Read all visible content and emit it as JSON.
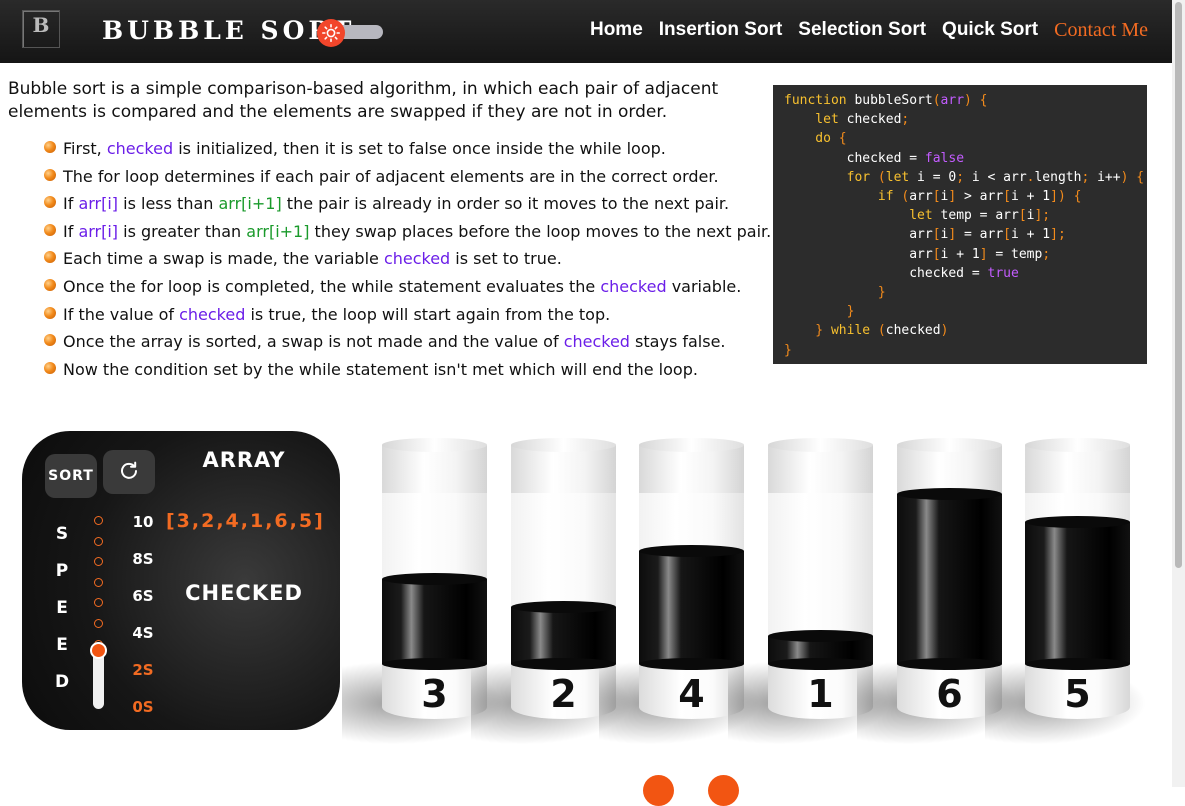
{
  "nav": {
    "logo": "B",
    "brand": "BUBBLE SORT",
    "links": [
      "Home",
      "Insertion Sort",
      "Selection Sort",
      "Quick Sort",
      "Contact Me"
    ],
    "active": "Contact Me",
    "theme_toggle_icon": "sun-icon"
  },
  "intro": {
    "text": "Bubble sort is a simple comparison-based algorithm, in which each pair of adjacent elements is compared and the elements are swapped if they are not in order."
  },
  "steps": [
    {
      "parts": [
        {
          "t": "First, "
        },
        {
          "t": "checked",
          "c": "purple"
        },
        {
          "t": " is initialized, then it is set to false once inside the while loop."
        }
      ]
    },
    {
      "parts": [
        {
          "t": "The for loop determines if each pair of adjacent elements are in the correct order."
        }
      ]
    },
    {
      "parts": [
        {
          "t": "If "
        },
        {
          "t": "arr[i]",
          "c": "purple"
        },
        {
          "t": " is less than "
        },
        {
          "t": "arr[i+1]",
          "c": "green"
        },
        {
          "t": " the pair is already in order so it moves to the next pair."
        }
      ]
    },
    {
      "parts": [
        {
          "t": "If "
        },
        {
          "t": "arr[i]",
          "c": "purple"
        },
        {
          "t": " is greater than "
        },
        {
          "t": "arr[i+1]",
          "c": "green"
        },
        {
          "t": " they swap places before the loop moves to the next pair."
        }
      ]
    },
    {
      "parts": [
        {
          "t": "Each time a swap is made, the variable "
        },
        {
          "t": "checked",
          "c": "purple"
        },
        {
          "t": " is set to true."
        }
      ]
    },
    {
      "parts": [
        {
          "t": "Once the for loop is completed, the while statement evaluates the "
        },
        {
          "t": "checked",
          "c": "purple"
        },
        {
          "t": " variable."
        }
      ]
    },
    {
      "parts": [
        {
          "t": "If the value of "
        },
        {
          "t": "checked",
          "c": "purple"
        },
        {
          "t": " is true, the loop will start again from the top."
        }
      ]
    },
    {
      "parts": [
        {
          "t": "Once the array is sorted, a swap is not made and the value of "
        },
        {
          "t": "checked",
          "c": "purple"
        },
        {
          "t": " stays false."
        }
      ]
    },
    {
      "parts": [
        {
          "t": "Now the condition set by the while statement isn't met which will end the loop."
        }
      ]
    }
  ],
  "code_lines": [
    [
      [
        "function",
        "kw"
      ],
      [
        " bubbleSort",
        "w"
      ],
      [
        "(",
        "p"
      ],
      [
        "arr",
        "v"
      ],
      [
        ")",
        "p"
      ],
      [
        " {",
        "p"
      ]
    ],
    [
      [
        "    let",
        "kw"
      ],
      [
        " checked",
        "w"
      ],
      [
        ";",
        "p"
      ]
    ],
    [
      [
        "    do",
        "kw"
      ],
      [
        " {",
        "p"
      ]
    ],
    [
      [
        "        checked ",
        "w"
      ],
      [
        "=",
        "w"
      ],
      [
        " false",
        "v"
      ]
    ],
    [
      [
        "        for",
        "kw"
      ],
      [
        " (",
        "p"
      ],
      [
        "let",
        "kw"
      ],
      [
        " i = 0",
        "w"
      ],
      [
        ";",
        "p"
      ],
      [
        " i < arr",
        "w"
      ],
      [
        ".",
        "p"
      ],
      [
        "length",
        "w"
      ],
      [
        ";",
        "p"
      ],
      [
        " i++",
        "w"
      ],
      [
        ")",
        "p"
      ],
      [
        " {",
        "p"
      ]
    ],
    [
      [
        "            if",
        "kw"
      ],
      [
        " (",
        "p"
      ],
      [
        "arr",
        "w"
      ],
      [
        "[",
        "p"
      ],
      [
        "i",
        "w"
      ],
      [
        "]",
        "p"
      ],
      [
        " > arr",
        "w"
      ],
      [
        "[",
        "p"
      ],
      [
        "i + 1",
        "w"
      ],
      [
        "])",
        "p"
      ],
      [
        " {",
        "p"
      ]
    ],
    [
      [
        "                let",
        "kw"
      ],
      [
        " temp = arr",
        "w"
      ],
      [
        "[",
        "p"
      ],
      [
        "i",
        "w"
      ],
      [
        "]",
        "p"
      ],
      [
        ";",
        "p"
      ]
    ],
    [
      [
        "                arr",
        "w"
      ],
      [
        "[",
        "p"
      ],
      [
        "i",
        "w"
      ],
      [
        "]",
        "p"
      ],
      [
        " = arr",
        "w"
      ],
      [
        "[",
        "p"
      ],
      [
        "i + 1",
        "w"
      ],
      [
        "]",
        "p"
      ],
      [
        ";",
        "p"
      ]
    ],
    [
      [
        "                arr",
        "w"
      ],
      [
        "[",
        "p"
      ],
      [
        "i + 1",
        "w"
      ],
      [
        "]",
        "p"
      ],
      [
        " = temp",
        "w"
      ],
      [
        ";",
        "p"
      ]
    ],
    [
      [
        "                checked = ",
        "w"
      ],
      [
        "true",
        "v"
      ]
    ],
    [
      [
        "            }",
        "p"
      ]
    ],
    [
      [
        "        }",
        "p"
      ]
    ],
    [
      [
        "    }",
        "p"
      ],
      [
        " while",
        "kw"
      ],
      [
        " (",
        "p"
      ],
      [
        "checked",
        "w"
      ],
      [
        ")",
        "p"
      ]
    ],
    [
      [
        "}",
        "p"
      ]
    ]
  ],
  "panel": {
    "sort_label": "SORT",
    "reset_icon": "refresh-icon",
    "speed_letters": [
      "S",
      "P",
      "E",
      "E",
      "D"
    ],
    "speed_values": [
      "10",
      "8S",
      "6S",
      "4S",
      "2S",
      "0S"
    ],
    "speed_selected": [
      "2S",
      "0S"
    ],
    "array_title": "ARRAY",
    "array_text": "[3,2,4,1,6,5]",
    "status": "CHECKED"
  },
  "array": [
    3,
    2,
    4,
    1,
    6,
    5
  ],
  "array_max": 6,
  "colors": {
    "accent": "#f25512",
    "nav_active": "#f26b22",
    "purple": "#6b1ee8",
    "green": "#1a9a2b"
  }
}
